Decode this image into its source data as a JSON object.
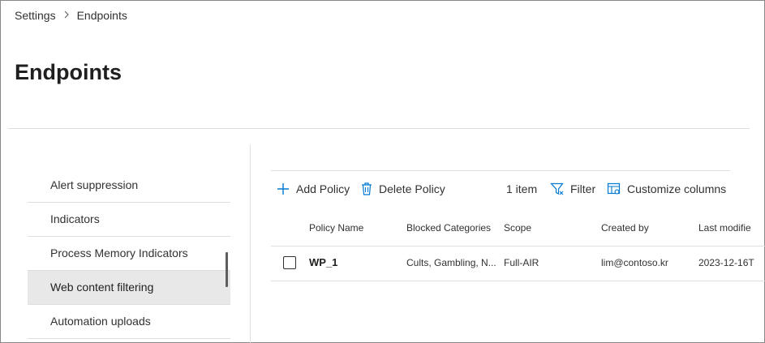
{
  "breadcrumb": {
    "root": "Settings",
    "current": "Endpoints"
  },
  "page": {
    "title": "Endpoints"
  },
  "sidebar": {
    "items": [
      {
        "label": "Alert suppression"
      },
      {
        "label": "Indicators"
      },
      {
        "label": "Process Memory Indicators"
      },
      {
        "label": "Web content filtering",
        "selected": true
      },
      {
        "label": "Automation uploads"
      }
    ]
  },
  "toolbar": {
    "add_label": "Add Policy",
    "delete_label": "Delete Policy",
    "item_count": "1 item",
    "filter_label": "Filter",
    "customize_label": "Customize columns",
    "accent": "#0078d4"
  },
  "table": {
    "headers": [
      "Policy Name",
      "Blocked Categories",
      "Scope",
      "Created by",
      "Last modifie"
    ],
    "rows": [
      {
        "name": "WP_1",
        "categories": "Cults, Gambling, N...",
        "scope": "Full-AIR",
        "created_by": "lim@contoso.kr",
        "last_modified": "2023-12-16T"
      }
    ]
  }
}
